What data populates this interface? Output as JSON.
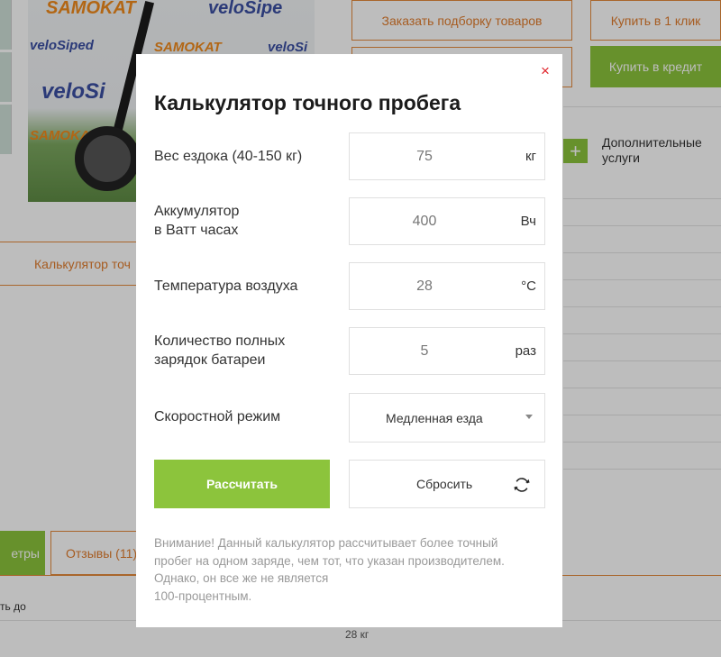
{
  "background": {
    "product_image_logos": [
      "SAMOKAT",
      "veloSiped",
      "veloSipe",
      "veloSi",
      "SAMOKAT",
      "SAMOKAT",
      "veloSi"
    ],
    "buttons": {
      "order_selection": "Заказать подборку товаров",
      "buy_one_click": "Купить в 1 клик",
      "buy_credit": "Купить в кредит"
    },
    "additional_services": "Дополнительные услуги",
    "calculator_tab": "Калькулятор точ",
    "tabs": {
      "params": "етры",
      "reviews": "Отзывы (11)"
    },
    "spec_label": "ть до",
    "spec_value": "28 кг"
  },
  "modal": {
    "title": "Калькулятор точного пробега",
    "close_symbol": "×",
    "fields": [
      {
        "label": "Вес ездока (40-150 кг)",
        "value": "75",
        "unit": "кг"
      },
      {
        "label": "Аккумулятор\nв Ватт часах",
        "value": "400",
        "unit": "Вч"
      },
      {
        "label": "Температура воздуха",
        "value": "28",
        "unit": "°C"
      },
      {
        "label": "Количество полных\nзарядок батареи",
        "value": "5",
        "unit": "раз"
      }
    ],
    "speed_mode": {
      "label": "Скоростной режим",
      "selected": "Медленная езда"
    },
    "calculate_label": "Рассчитать",
    "reset_label": "Сбросить",
    "note": "Внимание! Данный калькулятор рассчитывает более точный\nпробег на одном заряде, чем тот, что указан производителем.\nОднако, он все же не является\n100-процентным."
  },
  "colors": {
    "accent_green": "#8cc43c",
    "accent_orange": "#e17c2d",
    "close_red": "#e0242b"
  }
}
